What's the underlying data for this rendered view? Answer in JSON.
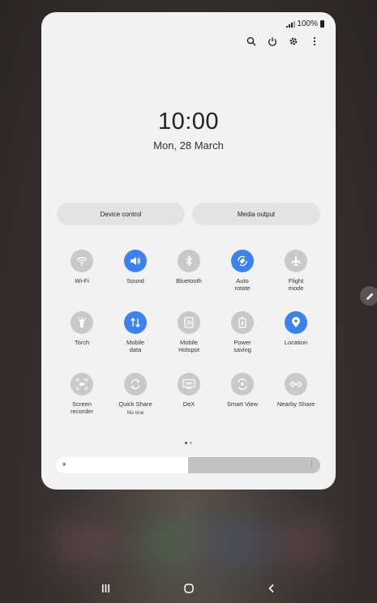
{
  "status": {
    "battery": "100%"
  },
  "header": {
    "icons": [
      "search-icon",
      "power-icon",
      "gear-icon",
      "more-vertical-icon"
    ]
  },
  "clock": {
    "time": "10:00",
    "date": "Mon, 28 March"
  },
  "buttons": {
    "device_control": "Device control",
    "media_output": "Media output"
  },
  "tiles": [
    {
      "label": "Wi-Fi",
      "icon": "wifi-icon",
      "on": false
    },
    {
      "label": "Sound",
      "icon": "sound-icon",
      "on": true
    },
    {
      "label": "Bluetooth",
      "icon": "bluetooth-icon",
      "on": false
    },
    {
      "label": "Auto rotate",
      "icon": "auto-rotate-icon",
      "on": true
    },
    {
      "label": "Flight mode",
      "icon": "airplane-icon",
      "on": false
    },
    {
      "label": "Torch",
      "icon": "torch-icon",
      "on": false
    },
    {
      "label": "Mobile data",
      "icon": "mobile-data-icon",
      "on": true
    },
    {
      "label": "Mobile Hotspot",
      "icon": "hotspot-icon",
      "on": false
    },
    {
      "label": "Power saving",
      "icon": "power-saving-icon",
      "on": false
    },
    {
      "label": "Location",
      "icon": "location-icon",
      "on": true
    },
    {
      "label": "Screen recorder",
      "icon": "screen-recorder-icon",
      "on": false
    },
    {
      "label": "Quick Share",
      "sublabel": "No one",
      "icon": "quick-share-icon",
      "on": false
    },
    {
      "label": "DeX",
      "icon": "dex-icon",
      "on": false
    },
    {
      "label": "Smart View",
      "icon": "smart-view-icon",
      "on": false
    },
    {
      "label": "Nearby Share",
      "icon": "nearby-share-icon",
      "on": false
    }
  ],
  "brightness": {
    "level": 0.5,
    "icon": "sun-icon"
  },
  "pager": {
    "pages": 2,
    "current": 1
  },
  "colors": {
    "accent": "#3b82f0",
    "tile_off": "#c9c9c9",
    "panel": "#f2f2f2"
  },
  "nav": {
    "icons": [
      "recents-icon",
      "home-icon",
      "back-icon"
    ]
  }
}
